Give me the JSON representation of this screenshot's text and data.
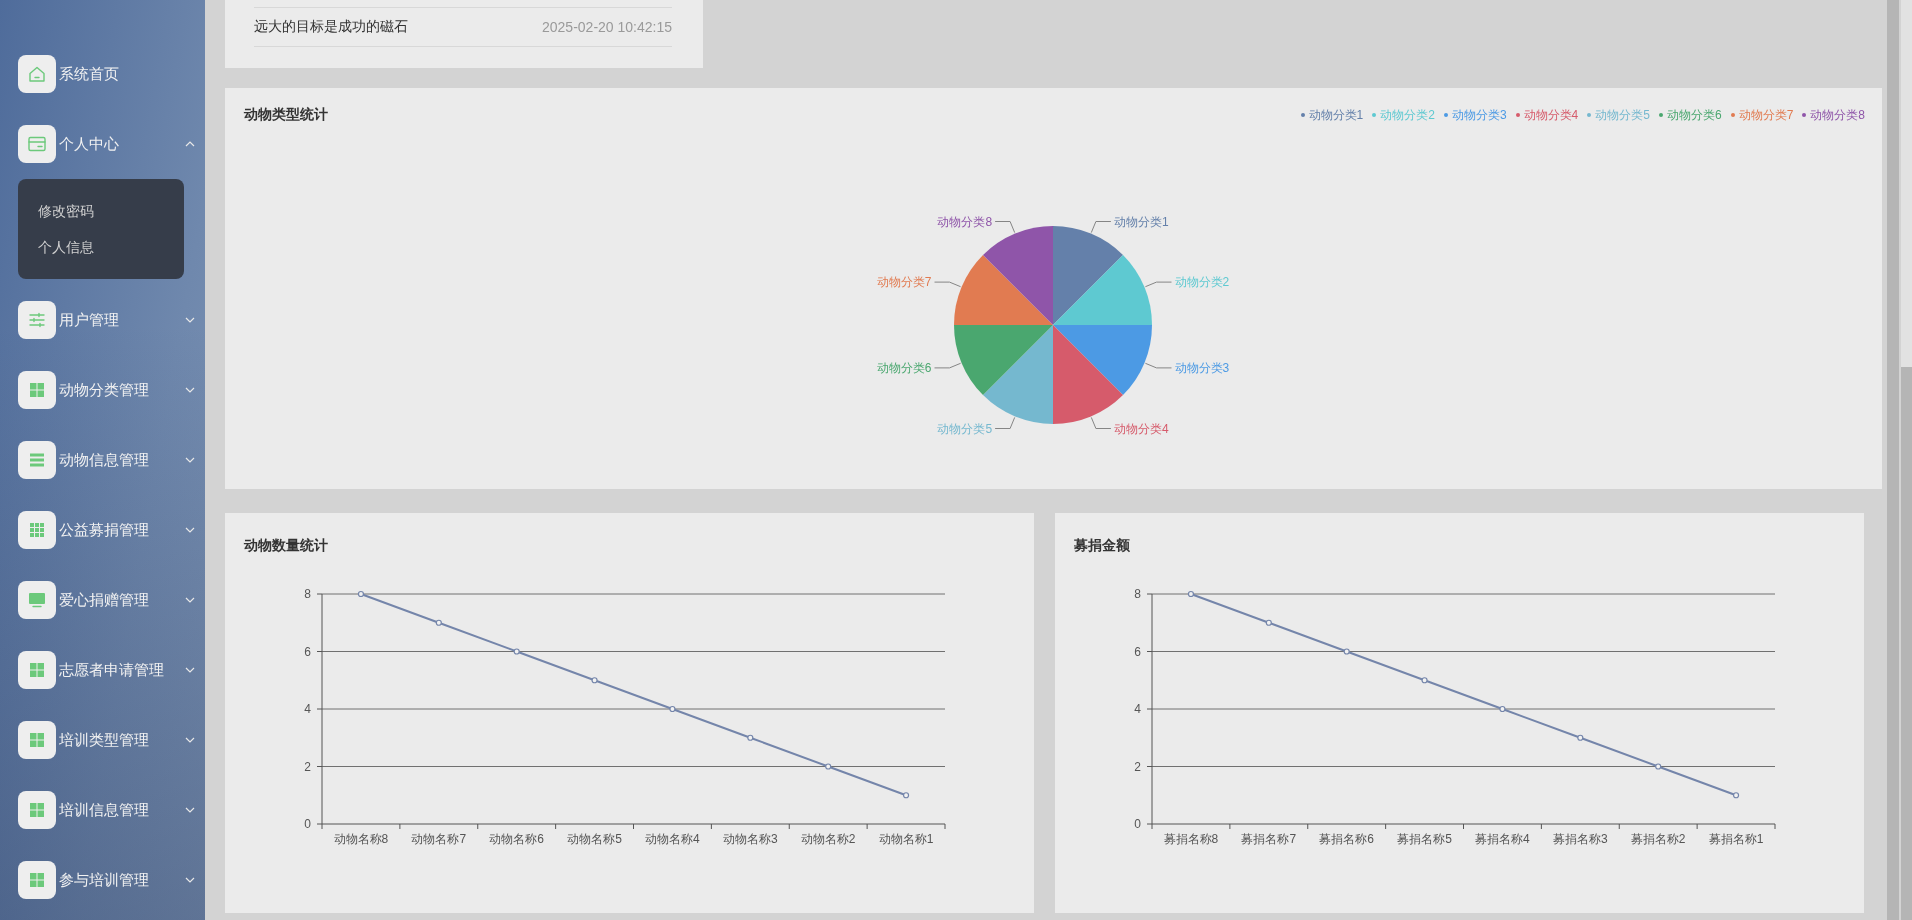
{
  "sidebar": {
    "items": [
      {
        "label": "系统首页"
      },
      {
        "label": "个人中心",
        "expanded": true,
        "children": [
          {
            "label": "修改密码"
          },
          {
            "label": "个人信息"
          }
        ]
      },
      {
        "label": "用户管理",
        "expanded": false
      },
      {
        "label": "动物分类管理",
        "expanded": false
      },
      {
        "label": "动物信息管理",
        "expanded": false
      },
      {
        "label": "公益募捐管理",
        "expanded": false
      },
      {
        "label": "爱心捐赠管理",
        "expanded": false
      },
      {
        "label": "志愿者申请管理",
        "expanded": false
      },
      {
        "label": "培训类型管理",
        "expanded": false
      },
      {
        "label": "培训信息管理",
        "expanded": false
      },
      {
        "label": "参与培训管理",
        "expanded": false
      }
    ]
  },
  "notice_card": {
    "rows": [
      {
        "title": "远大的目标是成功的磁石",
        "time": "2025-02-20 10:42:15"
      }
    ]
  },
  "animal_type_panel": {
    "title": "动物类型统计",
    "legend": [
      {
        "label": "动物分类1",
        "color": "#6480aa"
      },
      {
        "label": "动物分类2",
        "color": "#5ec9d1"
      },
      {
        "label": "动物分类3",
        "color": "#4c9ae4"
      },
      {
        "label": "动物分类4",
        "color": "#d65b6b"
      },
      {
        "label": "动物分类5",
        "color": "#75b8cf"
      },
      {
        "label": "动物分类6",
        "color": "#4aa76f"
      },
      {
        "label": "动物分类7",
        "color": "#e17b51"
      },
      {
        "label": "动物分类8",
        "color": "#8f55a9"
      }
    ],
    "slices": [
      {
        "label": "动物分类1",
        "color": "#6480aa"
      },
      {
        "label": "动物分类2",
        "color": "#5ec9d1"
      },
      {
        "label": "动物分类3",
        "color": "#4c9ae4"
      },
      {
        "label": "动物分类4",
        "color": "#d65b6b"
      },
      {
        "label": "动物分类5",
        "color": "#75b8cf"
      },
      {
        "label": "动物分类6",
        "color": "#4aa76f"
      },
      {
        "label": "动物分类7",
        "color": "#e17b51"
      },
      {
        "label": "动物分类8",
        "color": "#8f55a9"
      }
    ]
  },
  "animal_count_panel": {
    "chart_data": {
      "type": "line",
      "title": "动物数量统计",
      "categories": [
        "动物名称8",
        "动物名称7",
        "动物名称6",
        "动物名称5",
        "动物名称4",
        "动物名称3",
        "动物名称2",
        "动物名称1"
      ],
      "series": [
        {
          "color": "#7485aa",
          "marker": "circle",
          "values": [
            8,
            7,
            6,
            5,
            4,
            3,
            2,
            1
          ]
        }
      ],
      "ylim": [
        0,
        8
      ],
      "yticks": [
        0,
        2,
        4,
        6,
        8
      ],
      "grid": true
    }
  },
  "donation_panel": {
    "chart_data": {
      "type": "line",
      "title": "募捐金额",
      "categories": [
        "募捐名称8",
        "募捐名称7",
        "募捐名称6",
        "募捐名称5",
        "募捐名称4",
        "募捐名称3",
        "募捐名称2",
        "募捐名称1"
      ],
      "series": [
        {
          "color": "#7485aa",
          "marker": "circle",
          "values": [
            8,
            7,
            6,
            5,
            4,
            3,
            2,
            1
          ]
        }
      ],
      "ylim": [
        0,
        8
      ],
      "yticks": [
        0,
        2,
        4,
        6,
        8
      ],
      "grid": true
    }
  }
}
